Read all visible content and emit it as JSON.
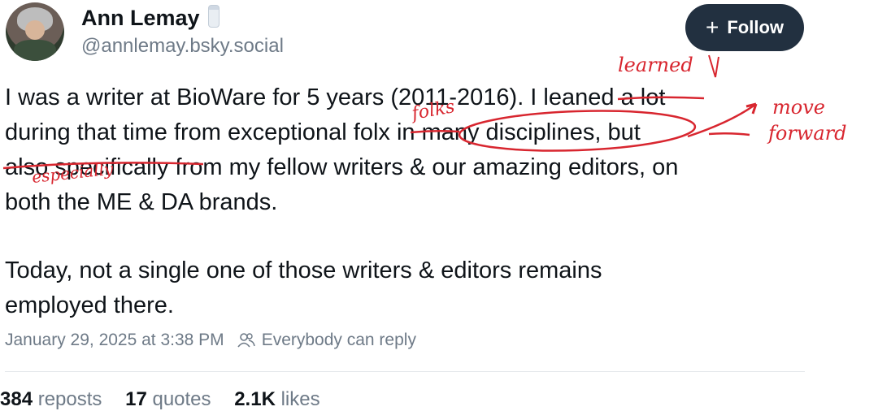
{
  "author": {
    "name": "Ann Lemay",
    "handle": "@annlemay.bsky.social",
    "emoji_icon": "salt-shaker-icon"
  },
  "follow_button": {
    "label": "Follow",
    "icon": "plus-icon"
  },
  "post": {
    "lines": [
      "I was a writer at BioWare for 5 years (2011-2016). I leaned a lot",
      "during that time from exceptional folx in many disciplines, but",
      "also specifically from my fellow writers & our amazing editors, on",
      "both the ME & DA brands.",
      "Today, not a single one of those writers & editors remains",
      "employed there."
    ]
  },
  "annotations": {
    "learned": "learned",
    "folks": "folks",
    "move_forward_1": "move",
    "move_forward_2": "forward",
    "especially": "especially",
    "color": "#d8262f"
  },
  "meta": {
    "timestamp": "January 29, 2025 at 3:38 PM",
    "reply_setting": "Everybody can reply"
  },
  "stats": {
    "reposts_count": "384",
    "reposts_label": "reposts",
    "quotes_count": "17",
    "quotes_label": "quotes",
    "likes_count": "2.1K",
    "likes_label": "likes"
  }
}
